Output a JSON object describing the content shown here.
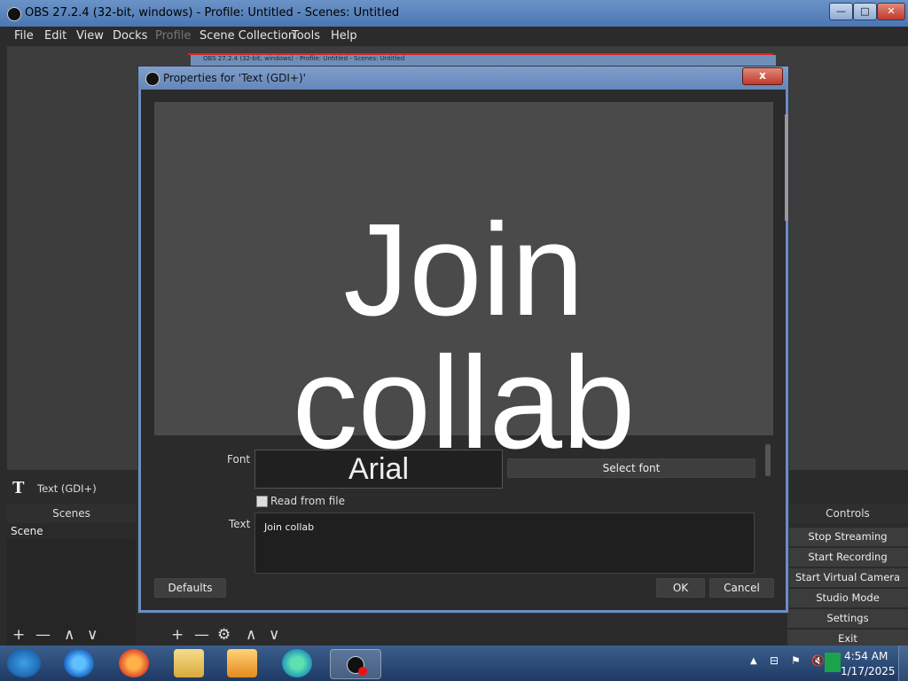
{
  "window": {
    "title": "OBS 27.2.4 (32-bit, windows) - Profile: Untitled - Scenes: Untitled",
    "min": "—",
    "max": "□",
    "close": "✕"
  },
  "menu": {
    "file": "File",
    "edit": "Edit",
    "view": "View",
    "docks": "Docks",
    "profile": "Profile",
    "scene_collection": "Scene Collection",
    "tools": "Tools",
    "help": "Help"
  },
  "inner_window_title": "OBS 27.2.4 (32-bit, windows) - Profile: Untitled - Scenes: Untitled",
  "source": {
    "icon": "T",
    "label": "Text (GDI+)"
  },
  "scenes": {
    "header": "Scenes",
    "items": [
      "Scene"
    ]
  },
  "controls": {
    "header": "Controls",
    "buttons": [
      "Stop Streaming",
      "Start Recording",
      "Start Virtual Camera",
      "Studio Mode",
      "Settings",
      "Exit"
    ]
  },
  "toolbar_icons": {
    "add": "+",
    "remove": "—",
    "up": "∧",
    "down": "∨",
    "settings": "⚙"
  },
  "dialog": {
    "title": "Properties for 'Text (GDI+)'",
    "close": "x",
    "preview_text": "Join collab",
    "font_label": "Font",
    "font_value": "Arial",
    "select_font": "Select font",
    "read_from_file": "Read from file",
    "text_label": "Text",
    "text_value": "Join collab",
    "defaults": "Defaults",
    "ok": "OK",
    "cancel": "Cancel"
  },
  "taskbar": {
    "time": "4:54 AM",
    "date": "1/17/2025",
    "icons": [
      "windows-start-icon",
      "internet-explorer-icon",
      "firefox-icon",
      "file-explorer-icon",
      "media-player-icon",
      "edge-icon",
      "obs-icon"
    ]
  },
  "colors": {
    "dark_bg": "#2b2b2b",
    "title_blue": "#4a76b3",
    "close_red": "#c0392b"
  }
}
